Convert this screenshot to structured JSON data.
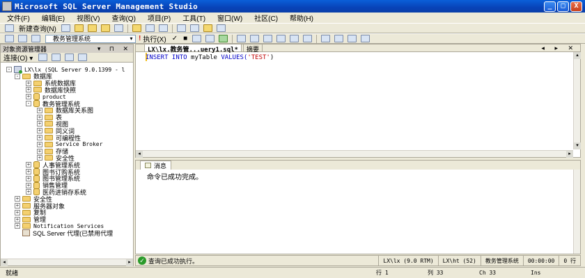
{
  "window": {
    "title": "Microsoft SQL Server Management Studio",
    "minimize": "_",
    "maximize": "□",
    "close": "X"
  },
  "menu": [
    "文件(F)",
    "编辑(E)",
    "视图(V)",
    "查询(Q)",
    "项目(P)",
    "工具(T)",
    "窗口(W)",
    "社区(C)",
    "帮助(H)"
  ],
  "toolbar": {
    "new_query": "新建查询(N)",
    "database": "教务管理系统",
    "execute": "执行(X)",
    "check": "✓",
    "stop": "■"
  },
  "object_explorer": {
    "title": "对象资源管理器",
    "controls": "▾ ⊓ ✕",
    "connect": "连接(O) ▾",
    "tree": [
      {
        "label": "LX\\lx (SQL Server 9.0.1399 - l",
        "exp": "-",
        "icon": "server-icon"
      },
      {
        "label": "数据库",
        "exp": "-",
        "icon": "folder-icon"
      },
      {
        "label": "系统数据库",
        "exp": "+",
        "icon": "folder-icon"
      },
      {
        "label": "数据库快照",
        "exp": "+",
        "icon": "folder-icon"
      },
      {
        "label": "product",
        "exp": "+",
        "icon": "database-icon"
      },
      {
        "label": "教务管理系统",
        "exp": "-",
        "icon": "database-icon"
      },
      {
        "label": "数据库关系图",
        "exp": "+",
        "icon": "folder-icon"
      },
      {
        "label": "表",
        "exp": "+",
        "icon": "folder-icon"
      },
      {
        "label": "视图",
        "exp": "+",
        "icon": "folder-icon"
      },
      {
        "label": "同义词",
        "exp": "+",
        "icon": "folder-icon"
      },
      {
        "label": "可编程性",
        "exp": "+",
        "icon": "folder-icon"
      },
      {
        "label": "Service Broker",
        "exp": "+",
        "icon": "folder-icon"
      },
      {
        "label": "存储",
        "exp": "+",
        "icon": "folder-icon"
      },
      {
        "label": "安全性",
        "exp": "+",
        "icon": "folder-icon"
      },
      {
        "label": "人事管理系统",
        "exp": "+",
        "icon": "database-icon"
      },
      {
        "label": "图书订购系统",
        "exp": "+",
        "icon": "database-icon"
      },
      {
        "label": "图书管理系统",
        "exp": "+",
        "icon": "database-icon"
      },
      {
        "label": "销售管理",
        "exp": "+",
        "icon": "database-icon"
      },
      {
        "label": "医药进销存系统",
        "exp": "+",
        "icon": "database-icon"
      },
      {
        "label": "安全性",
        "exp": "+",
        "icon": "folder-icon"
      },
      {
        "label": "服务器对象",
        "exp": "+",
        "icon": "folder-icon"
      },
      {
        "label": "复制",
        "exp": "+",
        "icon": "folder-icon"
      },
      {
        "label": "管理",
        "exp": "+",
        "icon": "folder-icon"
      },
      {
        "label": "Notification Services",
        "exp": "+",
        "icon": "folder-icon"
      },
      {
        "label": "SQL Server 代理(已禁用代理",
        "exp": "",
        "icon": "agent-icon"
      }
    ]
  },
  "editor": {
    "tab_active": "LX\\lx.教务管...uery1.sql*",
    "tab_summary": "摘要",
    "tab_controls": "◂ ▸ ✕",
    "code_keyword": "INSERT INTO ",
    "code_table": "myTable ",
    "code_values": "VALUES(",
    "code_string": "'TEST'",
    "code_close": ")"
  },
  "results": {
    "tab": "消息",
    "message": "命令已成功完成。"
  },
  "query_status": {
    "message": "查询已成功执行。",
    "server": "LX\\lx (9.0 RTM)",
    "user": "LX\\ht (52)",
    "database": "教务管理系统",
    "time": "00:00:00",
    "rows": "0 行"
  },
  "status": {
    "ready": "就绪",
    "line": "行 1",
    "col": "列 33",
    "ch": "Ch 33",
    "ins": "Ins"
  }
}
